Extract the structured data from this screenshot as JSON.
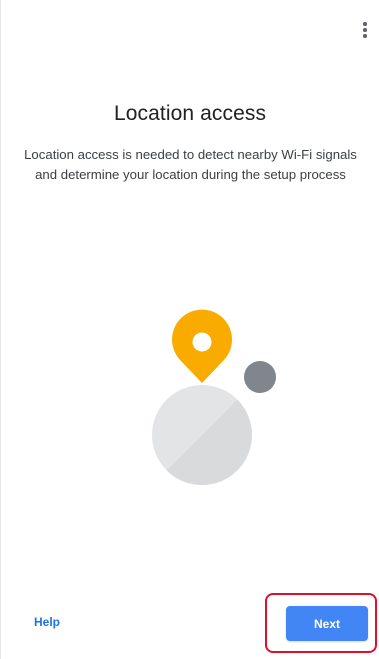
{
  "header": {
    "menu_icon": "more-vert-icon"
  },
  "main": {
    "title": "Location access",
    "description": "Location access is needed to detect nearby Wi-Fi signals and determine your location during the setup process",
    "illustration": {
      "pin_icon": "location-pin-icon",
      "pin_color": "#f9ab00",
      "globe_color": "#e3e4e6",
      "dot_color": "#80868b"
    }
  },
  "footer": {
    "help_label": "Help",
    "next_label": "Next",
    "accent_color": "#4285f4",
    "highlight_color": "#e0102a"
  }
}
